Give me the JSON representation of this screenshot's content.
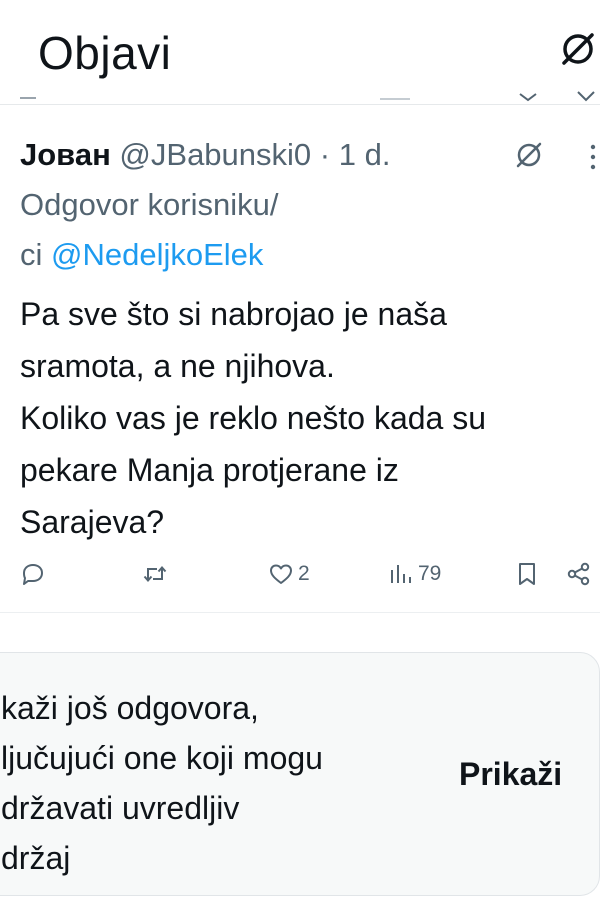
{
  "header": {
    "title": "Objavi",
    "icon": "circle-slash-icon"
  },
  "tweet": {
    "author_name": "Јован",
    "author_handle": "@JBabunski0",
    "separator": "·",
    "time": "1 d.",
    "reply_prefix_line1": "Odgovor korisniku/",
    "reply_prefix_line2": "ci",
    "reply_mention": "@NedeljkoElek",
    "text_lines": [
      "Pa sve što si nabrojao je naša",
      "sramota, a ne njihova.",
      "Koliko vas je reklo nešto kada su",
      "pekare Manja protjerane iz",
      "Sarajeva?"
    ],
    "actions": {
      "reply_icon": "reply-icon",
      "retweet_icon": "retweet-icon",
      "like_icon": "like-icon",
      "like_count": "2",
      "views_icon": "views-icon",
      "views_count": "79",
      "bookmark_icon": "bookmark-icon",
      "share_icon": "share-icon"
    }
  },
  "more_replies": {
    "lines": [
      "kaži još odgovora,",
      "ljučujući one koji mogu",
      "državati uvredljiv",
      "držaj"
    ],
    "button_label": "Prikaži"
  },
  "colors": {
    "text": "#0f1419",
    "muted": "#536471",
    "link": "#1d9bf0",
    "card_bg": "#f7f9f9",
    "border": "#e6e9eb"
  }
}
